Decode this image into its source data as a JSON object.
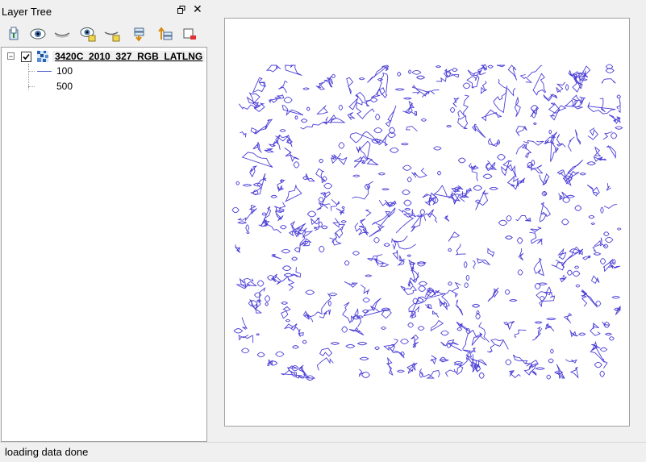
{
  "dock": {
    "title": "Layer Tree",
    "float_icon": "float-window-icon",
    "close_label": "✕"
  },
  "toolbar": {
    "buttons": [
      "add-layer-icon",
      "show-all-icon",
      "hide-all-icon",
      "show-selected-icon",
      "hide-selected-icon",
      "move-down-icon",
      "move-up-icon",
      "remove-layer-icon"
    ]
  },
  "tree": {
    "layer": {
      "name": "3420C_2010_327_RGB_LATLNG",
      "checked": true,
      "expanded": true,
      "expander_label": "−"
    },
    "legend": [
      {
        "label": "100",
        "color": "#5060d0"
      },
      {
        "label": "500"
      }
    ]
  },
  "map": {
    "contour_color": "#4b3fd6",
    "background": "#ffffff"
  },
  "status": {
    "text": "loading data done"
  }
}
